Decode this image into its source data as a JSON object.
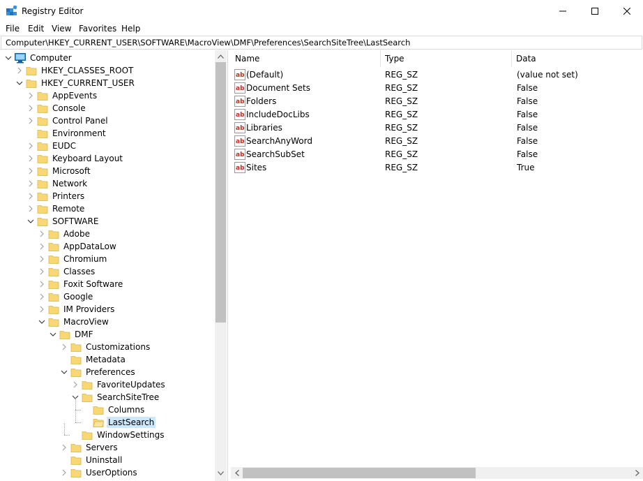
{
  "window": {
    "title": "Registry Editor"
  },
  "menu": {
    "file": "File",
    "edit": "Edit",
    "view": "View",
    "favorites": "Favorites",
    "help": "Help"
  },
  "address": "Computer\\HKEY_CURRENT_USER\\SOFTWARE\\MacroView\\DMF\\Preferences\\SearchSiteTree\\LastSearch",
  "tree": [
    {
      "label": "Computer",
      "depth": 0,
      "state": "expanded",
      "icon": "computer-icon"
    },
    {
      "label": "HKEY_CLASSES_ROOT",
      "depth": 1,
      "state": "collapsed",
      "icon": "folder-icon"
    },
    {
      "label": "HKEY_CURRENT_USER",
      "depth": 1,
      "state": "expanded",
      "icon": "folder-icon"
    },
    {
      "label": "AppEvents",
      "depth": 2,
      "state": "collapsed",
      "icon": "folder-icon"
    },
    {
      "label": "Console",
      "depth": 2,
      "state": "collapsed",
      "icon": "folder-icon"
    },
    {
      "label": "Control Panel",
      "depth": 2,
      "state": "collapsed",
      "icon": "folder-icon"
    },
    {
      "label": "Environment",
      "depth": 2,
      "state": "leaf",
      "icon": "folder-icon"
    },
    {
      "label": "EUDC",
      "depth": 2,
      "state": "collapsed",
      "icon": "folder-icon"
    },
    {
      "label": "Keyboard Layout",
      "depth": 2,
      "state": "collapsed",
      "icon": "folder-icon"
    },
    {
      "label": "Microsoft",
      "depth": 2,
      "state": "collapsed",
      "icon": "folder-icon"
    },
    {
      "label": "Network",
      "depth": 2,
      "state": "collapsed",
      "icon": "folder-icon"
    },
    {
      "label": "Printers",
      "depth": 2,
      "state": "collapsed",
      "icon": "folder-icon"
    },
    {
      "label": "Remote",
      "depth": 2,
      "state": "collapsed",
      "icon": "folder-icon"
    },
    {
      "label": "SOFTWARE",
      "depth": 2,
      "state": "expanded",
      "icon": "folder-icon"
    },
    {
      "label": "Adobe",
      "depth": 3,
      "state": "collapsed",
      "icon": "folder-icon"
    },
    {
      "label": "AppDataLow",
      "depth": 3,
      "state": "collapsed",
      "icon": "folder-icon"
    },
    {
      "label": "Chromium",
      "depth": 3,
      "state": "collapsed",
      "icon": "folder-icon"
    },
    {
      "label": "Classes",
      "depth": 3,
      "state": "collapsed",
      "icon": "folder-icon"
    },
    {
      "label": "Foxit Software",
      "depth": 3,
      "state": "collapsed",
      "icon": "folder-icon"
    },
    {
      "label": "Google",
      "depth": 3,
      "state": "collapsed",
      "icon": "folder-icon"
    },
    {
      "label": "IM Providers",
      "depth": 3,
      "state": "collapsed",
      "icon": "folder-icon"
    },
    {
      "label": "MacroView",
      "depth": 3,
      "state": "expanded",
      "icon": "folder-icon"
    },
    {
      "label": "DMF",
      "depth": 4,
      "state": "expanded",
      "icon": "folder-icon"
    },
    {
      "label": "Customizations",
      "depth": 5,
      "state": "collapsed",
      "icon": "folder-icon"
    },
    {
      "label": "Metadata",
      "depth": 5,
      "state": "leaf",
      "icon": "folder-icon"
    },
    {
      "label": "Preferences",
      "depth": 5,
      "state": "expanded",
      "icon": "folder-icon"
    },
    {
      "label": "FavoriteUpdates",
      "depth": 6,
      "state": "collapsed",
      "icon": "folder-icon"
    },
    {
      "label": "SearchSiteTree",
      "depth": 6,
      "state": "expanded",
      "icon": "folder-icon"
    },
    {
      "label": "Columns",
      "depth": 7,
      "state": "leaf",
      "icon": "folder-icon"
    },
    {
      "label": "LastSearch",
      "depth": 7,
      "state": "leaf",
      "icon": "folder-open-icon",
      "selected": true
    },
    {
      "label": "WindowSettings",
      "depth": 6,
      "state": "leaf",
      "icon": "folder-icon"
    },
    {
      "label": "Servers",
      "depth": 5,
      "state": "collapsed",
      "icon": "folder-icon"
    },
    {
      "label": "Uninstall",
      "depth": 5,
      "state": "leaf",
      "icon": "folder-icon"
    },
    {
      "label": "UserOptions",
      "depth": 5,
      "state": "collapsed",
      "icon": "folder-icon"
    }
  ],
  "list": {
    "columns": {
      "name": "Name",
      "type": "Type",
      "data": "Data"
    },
    "rows": [
      {
        "name": "(Default)",
        "type": "REG_SZ",
        "data": "(value not set)"
      },
      {
        "name": "Document Sets",
        "type": "REG_SZ",
        "data": "False"
      },
      {
        "name": "Folders",
        "type": "REG_SZ",
        "data": "False"
      },
      {
        "name": "IncludeDocLibs",
        "type": "REG_SZ",
        "data": "False"
      },
      {
        "name": "Libraries",
        "type": "REG_SZ",
        "data": "False"
      },
      {
        "name": "SearchAnyWord",
        "type": "REG_SZ",
        "data": "False"
      },
      {
        "name": "SearchSubSet",
        "type": "REG_SZ",
        "data": "False"
      },
      {
        "name": "Sites",
        "type": "REG_SZ",
        "data": "True"
      }
    ]
  },
  "colors": {
    "selection": "#cce8ff",
    "folder": "#f8d775",
    "string_icon": "#c42b1c",
    "accent": "#0078d7"
  }
}
